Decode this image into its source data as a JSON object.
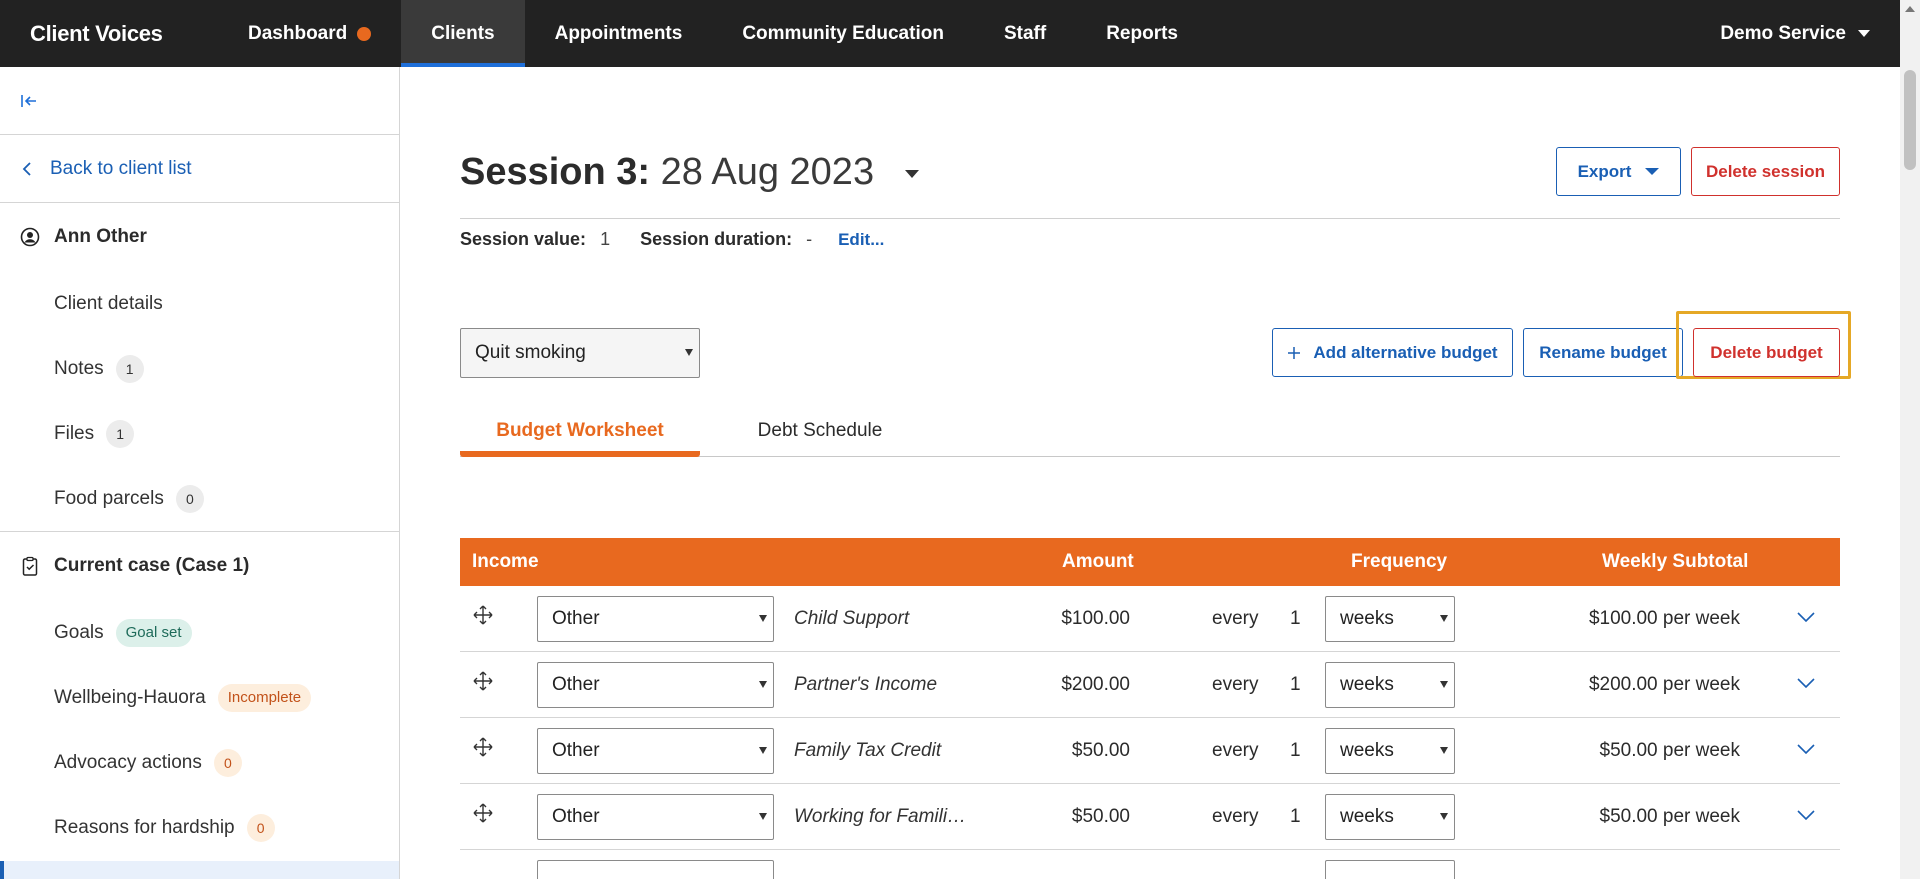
{
  "app": {
    "brand": "Client Voices",
    "nav": [
      {
        "label": "Dashboard"
      },
      {
        "label": "Clients"
      },
      {
        "label": "Appointments"
      },
      {
        "label": "Community Education"
      },
      {
        "label": "Staff"
      },
      {
        "label": "Reports"
      }
    ],
    "service": "Demo Service"
  },
  "sidebar": {
    "back": "Back to client list",
    "client_name": "Ann Other",
    "client_items": [
      {
        "label": "Client details",
        "count": ""
      },
      {
        "label": "Notes",
        "count": "1"
      },
      {
        "label": "Files",
        "count": "1"
      },
      {
        "label": "Food parcels",
        "count": "0"
      }
    ],
    "case_title": "Current case (Case 1)",
    "case_items": [
      {
        "label": "Goals",
        "badge": "Goal set"
      },
      {
        "label": "Wellbeing-Hauora",
        "badge": "Incomplete"
      },
      {
        "label": "Advocacy actions",
        "badge": "0"
      },
      {
        "label": "Reasons for hardship",
        "badge": "0"
      }
    ]
  },
  "session": {
    "label": "Session 3:",
    "date": "28 Aug 2023",
    "export_label": "Export",
    "delete_session_label": "Delete session",
    "value_label": "Session value:",
    "value": "1",
    "duration_label": "Session duration:",
    "duration": "-",
    "edit_label": "Edit..."
  },
  "budget": {
    "selected": "Quit smoking",
    "add_alt_label": "Add alternative budget",
    "rename_label": "Rename budget",
    "delete_label": "Delete budget",
    "tabs": [
      "Budget Worksheet",
      "Debt Schedule"
    ]
  },
  "table": {
    "headers": {
      "income": "Income",
      "amount": "Amount",
      "frequency": "Frequency",
      "subtotal": "Weekly Subtotal"
    },
    "rows": [
      {
        "type": "Other",
        "description": "Child Support",
        "amount": "$100.00",
        "every": "every",
        "n": "1",
        "unit": "weeks",
        "subtotal": "$100.00 per week"
      },
      {
        "type": "Other",
        "description": "Partner's Income",
        "amount": "$200.00",
        "every": "every",
        "n": "1",
        "unit": "weeks",
        "subtotal": "$200.00 per week"
      },
      {
        "type": "Other",
        "description": "Family Tax Credit",
        "amount": "$50.00",
        "every": "every",
        "n": "1",
        "unit": "weeks",
        "subtotal": "$50.00 per week"
      },
      {
        "type": "Other",
        "description": "Working for Famili…",
        "amount": "$50.00",
        "every": "every",
        "n": "1",
        "unit": "weeks",
        "subtotal": "$50.00 per week"
      }
    ]
  },
  "colors": {
    "accent": "#e8691f",
    "link": "#1a5fb4",
    "danger": "#d0312d",
    "focus": "#e5a826",
    "nav_bg": "#222222"
  }
}
